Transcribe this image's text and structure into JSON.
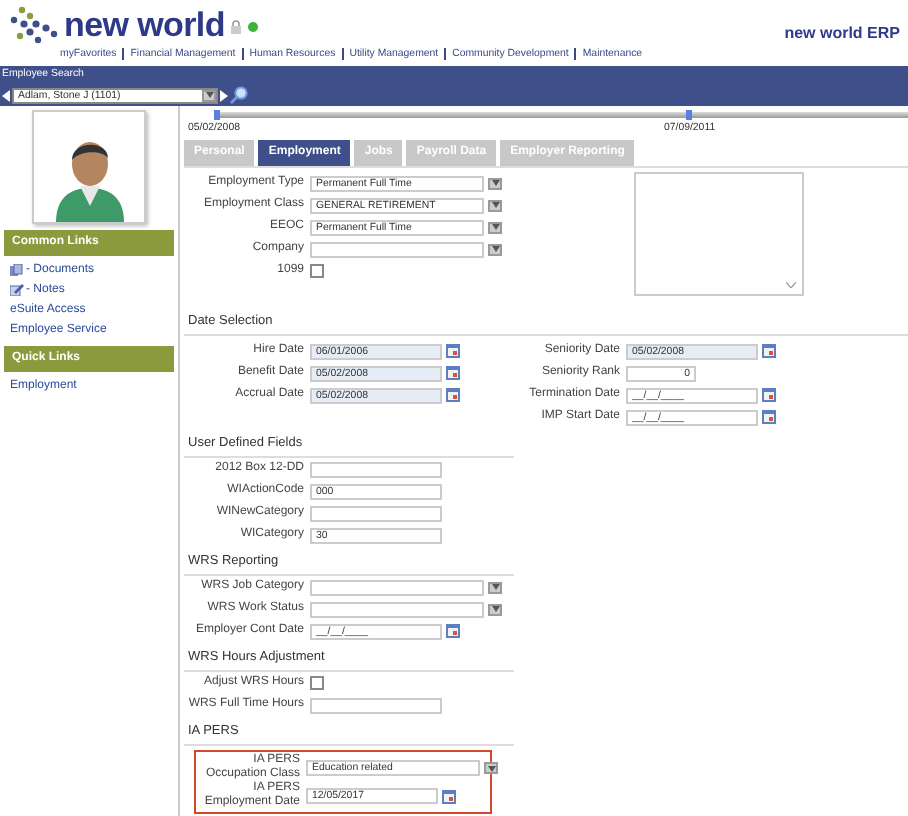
{
  "header": {
    "brand": "new world",
    "nav": [
      "myFavorites",
      "Financial Management",
      "Human Resources",
      "Utility Management",
      "Community Development",
      "Maintenance"
    ],
    "product": "new world ERP"
  },
  "search": {
    "title": "Employee Search",
    "value": "Adlam, Stone J (1101)"
  },
  "sidebar": {
    "sections": [
      {
        "title": "Common Links",
        "links": [
          {
            "label": "- Documents",
            "kind": "documents"
          },
          {
            "label": "- Notes",
            "kind": "notes"
          },
          {
            "label": "eSuite Access"
          },
          {
            "label": "Employee Service"
          }
        ]
      },
      {
        "title": "Quick Links",
        "links": [
          {
            "label": "Employment"
          }
        ]
      }
    ]
  },
  "timeline": {
    "start": "05/02/2008",
    "end": "07/09/2011"
  },
  "tabs": [
    {
      "label": "Personal",
      "selected": false
    },
    {
      "label": "Employment",
      "selected": true
    },
    {
      "label": "Jobs",
      "selected": false
    },
    {
      "label": "Payroll Data",
      "selected": false
    },
    {
      "label": "Employer Reporting",
      "selected": false
    }
  ],
  "employment": [
    {
      "label": "Employment Type",
      "kind": "select",
      "value": "Permanent Full Time"
    },
    {
      "label": "Employment Class",
      "kind": "select",
      "value": "GENERAL RETIREMENT"
    },
    {
      "label": "EEOC",
      "kind": "select",
      "value": "Permanent Full Time"
    },
    {
      "label": "Company",
      "kind": "select"
    },
    {
      "label": "1099",
      "kind": "checkbox",
      "checked": false
    }
  ],
  "date_selection": {
    "title": "Date Selection",
    "left": [
      {
        "label": "Hire Date",
        "kind": "date",
        "value": "06/01/2006",
        "readonly": true
      },
      {
        "label": "Benefit Date",
        "kind": "date",
        "value": "05/02/2008",
        "readonly": true
      },
      {
        "label": "Accrual Date",
        "kind": "date",
        "value": "05/02/2008",
        "readonly": true
      }
    ],
    "right": [
      {
        "label": "Seniority Date",
        "kind": "date",
        "value": "05/02/2008",
        "readonly": true
      },
      {
        "label": "Seniority Rank",
        "kind": "number",
        "value": "0"
      },
      {
        "label": "Termination Date",
        "kind": "date",
        "value": "__/__/____",
        "readonly": false
      },
      {
        "label": "IMP Start Date",
        "kind": "date",
        "value": "__/__/____",
        "readonly": false
      }
    ]
  },
  "sections": [
    {
      "title": "User Defined Fields",
      "highlighted": false,
      "rows": [
        {
          "label": "2012 Box 12-DD",
          "kind": "text"
        },
        {
          "label": "WIActionCode",
          "kind": "text",
          "value": "000"
        },
        {
          "label": "WINewCategory",
          "kind": "text"
        },
        {
          "label": "WICategory",
          "kind": "text",
          "value": "30"
        }
      ]
    },
    {
      "title": "WRS Reporting",
      "highlighted": false,
      "rows": [
        {
          "label": "WRS Job Category",
          "kind": "select"
        },
        {
          "label": "WRS Work Status",
          "kind": "select"
        },
        {
          "label": "Employer Cont Date",
          "kind": "date",
          "value": "__/__/____",
          "readonly": false
        }
      ]
    },
    {
      "title": "WRS Hours Adjustment",
      "highlighted": false,
      "rows": [
        {
          "label": "Adjust WRS Hours",
          "kind": "checkbox",
          "checked": false
        },
        {
          "label": "WRS Full Time Hours",
          "kind": "text"
        }
      ]
    },
    {
      "title": "IA PERS",
      "highlighted": true,
      "rows": [
        {
          "label": "IA PERS Occupation Class",
          "kind": "select",
          "value": "Education related"
        },
        {
          "label": "IA PERS Employment Date",
          "kind": "date",
          "value": "12/05/2017",
          "readonly": false
        }
      ]
    }
  ]
}
